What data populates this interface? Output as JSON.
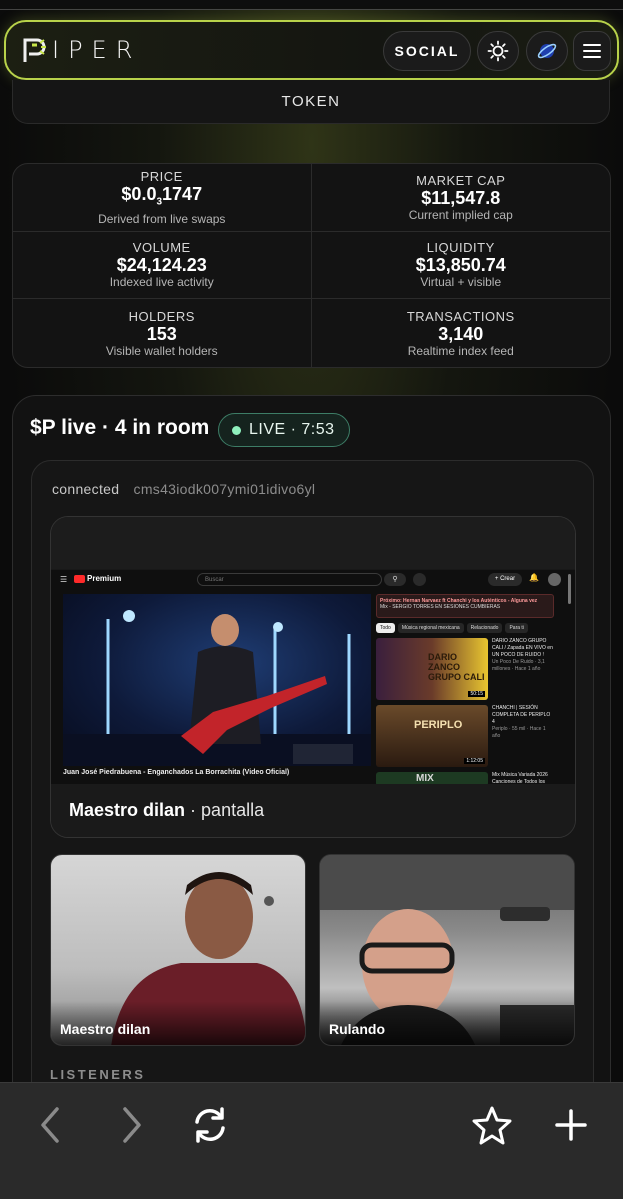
{
  "header": {
    "logo_text": "IPER",
    "logo_letter": "P",
    "social_label": "SOCIAL",
    "icons": [
      "sun-icon",
      "globe-icon",
      "menu-icon"
    ]
  },
  "token_tab": "TOKEN",
  "stats": [
    {
      "label": "PRICE",
      "value_main": "$0.0",
      "value_sub": "3",
      "value_tail": "1747",
      "note": "Derived from live swaps"
    },
    {
      "label": "MARKET CAP",
      "value": "$11,547.8",
      "note": "Current implied cap"
    },
    {
      "label": "VOLUME",
      "value": "$24,124.23",
      "note": "Indexed live activity"
    },
    {
      "label": "LIQUIDITY",
      "value": "$13,850.74",
      "note": "Virtual + visible"
    },
    {
      "label": "HOLDERS",
      "value": "153",
      "note": "Visible wallet holders"
    },
    {
      "label": "TRANSACTIONS",
      "value": "3,140",
      "note": "Realtime index feed"
    }
  ],
  "live": {
    "title": "$P live · 4 in room",
    "badge": "LIVE · 7:53",
    "accent": "#8ff0bd"
  },
  "room": {
    "status": "connected",
    "room_id": "cms43iodk007ymi01idivo6yl"
  },
  "screen_share": {
    "presenter": "Maestro dilan",
    "suffix": "· pantalla",
    "youtube": {
      "logo": "Premium",
      "search_placeholder": "Buscar",
      "create_label": "+ Crear",
      "video_title": "Juan José Piedrabuena - Enganchados La Borrachita (Video Oficial)",
      "next_up": "Próximo: Hernan Narvaez ft Chanchi y los Auténticos - Alguna vez",
      "next_sub": "Mix - SERGIO TORRES EN SESIONES CUMBIERAS",
      "chips": [
        "Todo",
        "Música regional mexicana",
        "Relacionado",
        "Para ti"
      ],
      "recommendations": [
        {
          "title": "DARIO ZANCO GRUPO CALI / Zapada EN VIVO en UN POCO DE RUIDO !",
          "meta": "Un Poco De Ruido · 3,1 millones · Hace 1 año",
          "duration": "50:15",
          "thumb_text": "DARIO ZANCO GRUPO CALI"
        },
        {
          "title": "CHANCHI | SESIÓN COMPLETA DE PERIPLO 4",
          "meta": "Periplo · 55 mil · Hace 1 año",
          "duration": "1:12:05",
          "thumb_text": "PERIPLO"
        },
        {
          "title": "Mix Música Variada 2026 Canciones de Todos los",
          "meta": "",
          "duration": "",
          "thumb_text": "MIX"
        }
      ]
    }
  },
  "participants": [
    {
      "name": "Maestro dilan"
    },
    {
      "name": "Rulando"
    }
  ],
  "listeners_label": "LISTENERS",
  "browser_bar": {
    "icons": [
      "back-arrow-icon",
      "forward-arrow-icon",
      "refresh-icon",
      "star-icon",
      "plus-icon"
    ]
  }
}
